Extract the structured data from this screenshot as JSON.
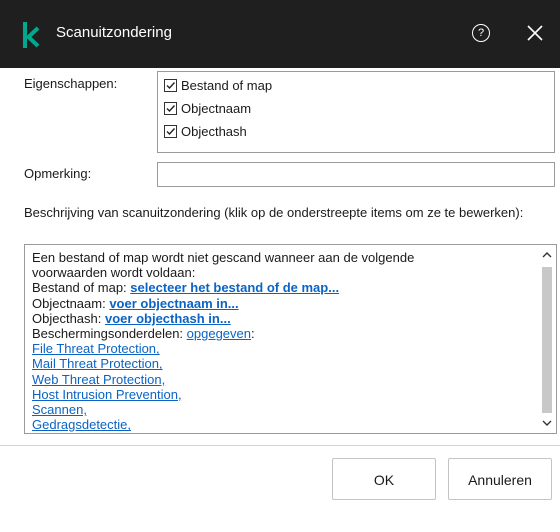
{
  "window": {
    "title": "Scanuitzondering",
    "help_symbol": "?",
    "accent_color": "#00a88e",
    "titlebar_color": "#1f1f1f",
    "link_color": "#0b63c4"
  },
  "properties": {
    "label": "Eigenschappen:",
    "options": [
      {
        "label": "Bestand of map",
        "checked": true
      },
      {
        "label": "Objectnaam",
        "checked": true
      },
      {
        "label": "Objecthash",
        "checked": true
      }
    ]
  },
  "remark": {
    "label": "Opmerking:",
    "value": ""
  },
  "description": {
    "label": "Beschrijving van scanuitzondering (klik op de onderstreepte items om ze te bewerken):",
    "intro_line1": "Een bestand of map wordt niet gescand wanneer aan de volgende",
    "intro_line2": "voorwaarden wordt voldaan:",
    "file_label": "Bestand of map: ",
    "file_link": "selecteer het bestand of de map...",
    "name_label": "Objectnaam: ",
    "name_link": "voer objectnaam in...",
    "hash_label": "Objecthash: ",
    "hash_link": "voer objecthash in...",
    "components_label": "Beschermingsonderdelen: ",
    "components_link": "opgegeven",
    "components_suffix": ":",
    "components": [
      "File Threat Protection,",
      "Mail Threat Protection,",
      "Web Threat Protection,",
      "Host Intrusion Prevention,",
      "Scannen,",
      "Gedragsdetectie,"
    ]
  },
  "buttons": {
    "ok": "OK",
    "cancel": "Annuleren"
  }
}
